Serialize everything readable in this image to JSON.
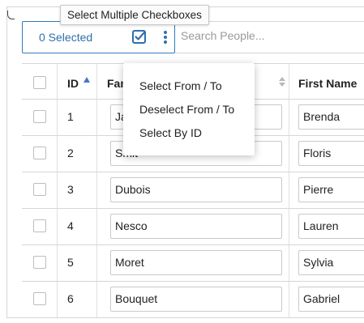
{
  "selection": {
    "count_label": "0 Selected",
    "checkbox_icon": "checkbox-check-icon",
    "more_icon": "more-vertical-icon"
  },
  "search": {
    "placeholder": "Search People..."
  },
  "tooltip": {
    "text": "Select Multiple Checkboxes"
  },
  "menu": {
    "items": [
      {
        "label": "Select From / To"
      },
      {
        "label": "Deselect From / To"
      },
      {
        "label": "Select By ID"
      }
    ]
  },
  "table": {
    "headers": {
      "id": "ID",
      "family_name": "Family Name",
      "first_name": "First Name"
    },
    "sort": {
      "column": "id",
      "direction": "ascending"
    },
    "rows": [
      {
        "id": "1",
        "family_name": "Jansen",
        "first_name": "Brenda"
      },
      {
        "id": "2",
        "family_name": "Smit",
        "first_name": "Floris"
      },
      {
        "id": "3",
        "family_name": "Dubois",
        "first_name": "Pierre"
      },
      {
        "id": "4",
        "family_name": "Nesco",
        "first_name": "Lauren"
      },
      {
        "id": "5",
        "family_name": "Moret",
        "first_name": "Sylvia"
      },
      {
        "id": "6",
        "family_name": "Bouquet",
        "first_name": "Gabriel"
      }
    ]
  },
  "colors": {
    "accent": "#2f6fae",
    "border": "#d6d6d6",
    "sort_active": "#4a74c9"
  }
}
